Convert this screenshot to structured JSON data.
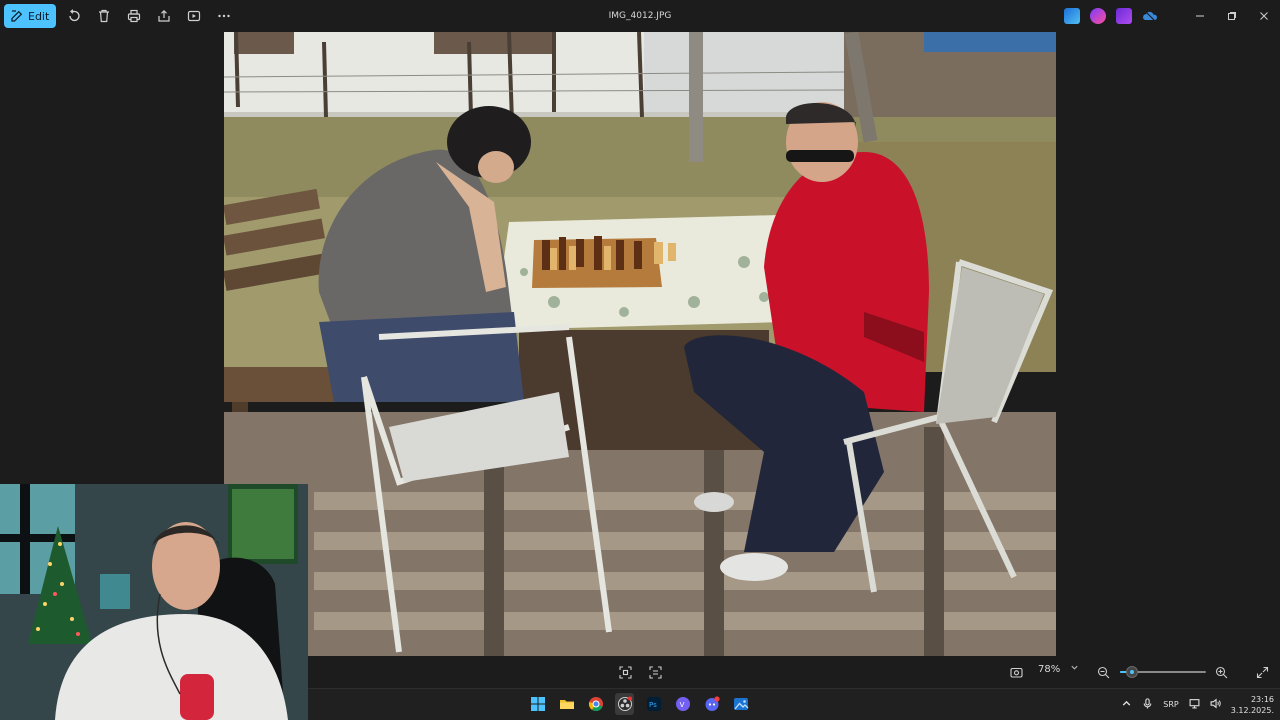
{
  "titlebar": {
    "edit_label": "Edit",
    "title": "IMG_4012.JPG"
  },
  "zoom": {
    "label": "78%",
    "level_percent": 78
  },
  "taskbar": {
    "language": "SRP",
    "time": "23:16",
    "date": "3.12.2025."
  },
  "colors": {
    "accent": "#4cc2ff",
    "titlebar_bg": "#1c1c1c",
    "taskbar_bg": "#202020"
  },
  "icons": {
    "titlebar_left": [
      "edit-icon",
      "rotate-icon",
      "delete-icon",
      "print-icon",
      "share-icon",
      "slideshow-icon",
      "more-icon"
    ],
    "titlebar_right": [
      "minimize-icon",
      "maximize-icon",
      "close-icon"
    ],
    "bottombar": [
      "fit-icon",
      "crop-icon",
      "screenshot-icon",
      "zoom-out-icon",
      "zoom-in-icon",
      "fullscreen-icon"
    ],
    "taskbar": [
      "start-icon",
      "file-explorer-icon",
      "chrome-icon",
      "obs-icon",
      "photoshop-icon",
      "viber-icon",
      "discord-icon",
      "photos-icon"
    ]
  }
}
